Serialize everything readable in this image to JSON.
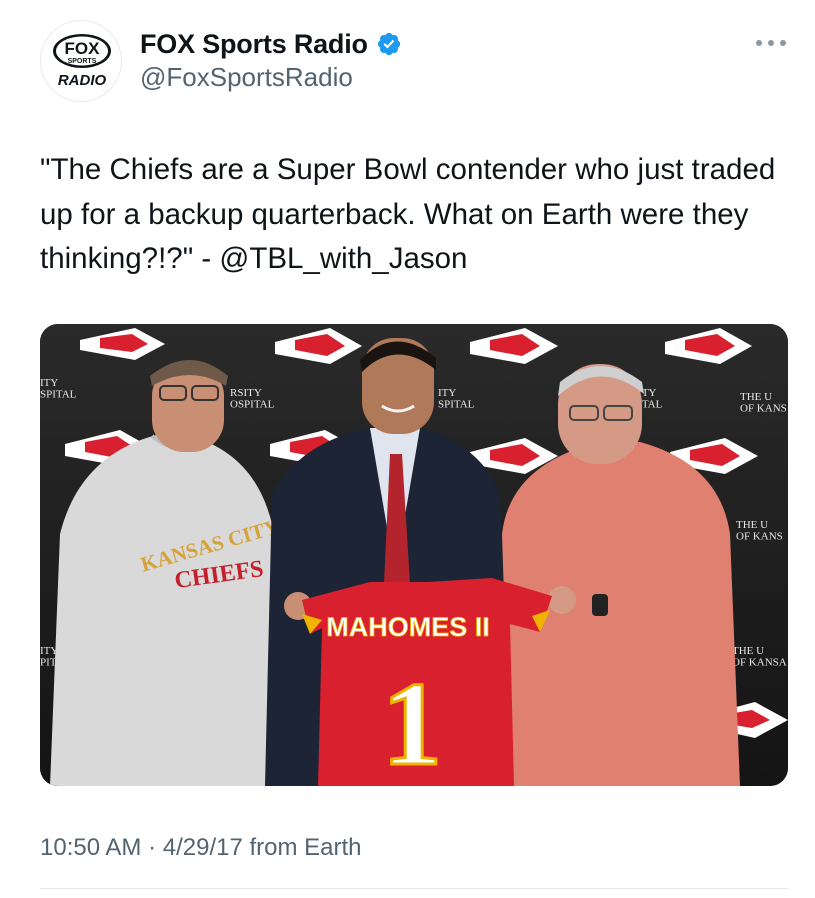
{
  "tweet": {
    "author": {
      "display_name": "FOX Sports Radio",
      "handle": "@FoxSportsRadio",
      "verified": true,
      "avatar_logo_text": [
        "FOX",
        "SPORTS",
        "RADIO"
      ]
    },
    "more_icon": "more-horizontal-icon",
    "text": "\"The Chiefs are a Super Bowl contender who just traded up for a backup quarterback. What on Earth were they thinking?!?\" - @TBL_with_Jason",
    "media": {
      "alt": "Photo",
      "sweatshirt_text": [
        "KANSAS CITY",
        "CHIEFS"
      ],
      "jersey_name": "MAHOMES II",
      "jersey_number": "1",
      "backdrop_text": [
        "ITY\nSPITAL",
        "RSITY\nOSPITAL",
        "ITY\nSPITAL",
        "ERSITY\nOSPITAL",
        "THE U\nOF KANS",
        "THE U\nOF KANS",
        "THE U\nOF KANSA",
        "ITY\nPITAL"
      ]
    },
    "time": "10:50 AM",
    "separator": "·",
    "date": "4/29/17",
    "source": "from Earth"
  },
  "colors": {
    "text_primary": "#0f1419",
    "text_secondary": "#536471",
    "verified_blue": "#1d9bf0",
    "chiefs_red": "#d8202e",
    "chiefs_gold": "#f0b400"
  }
}
